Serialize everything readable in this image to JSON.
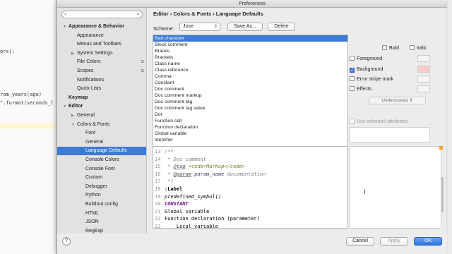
{
  "background_editor": {
    "lines": [
      "ors):",
      "rom_years(age)",
      "\".format(seconds_l"
    ]
  },
  "window": {
    "title": "Preferences"
  },
  "sidebar": {
    "search_placeholder": "",
    "items": [
      {
        "label": "Appearance & Behavior",
        "arrow": "▼",
        "bold": true
      },
      {
        "label": "Appearance"
      },
      {
        "label": "Menus and Toolbars"
      },
      {
        "label": "System Settings",
        "arrow": "▶"
      },
      {
        "label": "File Colors",
        "project_icon": "copy-icon"
      },
      {
        "label": "Scopes",
        "project_icon": "copy-icon"
      },
      {
        "label": "Notifications"
      },
      {
        "label": "Quick Lists"
      },
      {
        "label": "Keymap",
        "bold": true
      },
      {
        "label": "Editor",
        "arrow": "▼",
        "bold": true
      },
      {
        "label": "General",
        "arrow": "▶"
      },
      {
        "label": "Colors & Fonts",
        "arrow": "▼"
      },
      {
        "label": "Font"
      },
      {
        "label": "General"
      },
      {
        "label": "Language Defaults",
        "selected": true
      },
      {
        "label": "Console Colors"
      },
      {
        "label": "Console Font"
      },
      {
        "label": "Custom"
      },
      {
        "label": "Debugger"
      },
      {
        "label": "Python"
      },
      {
        "label": "Buildout config"
      },
      {
        "label": "HTML"
      },
      {
        "label": "JSON"
      },
      {
        "label": "RegExp"
      }
    ]
  },
  "main": {
    "breadcrumb": "Editor › Colors & Fonts › Language Defaults",
    "scheme_label": "Scheme:",
    "scheme_value": "Jose",
    "save_as_label": "Save As...",
    "delete_label": "Delete",
    "elements": [
      "Bad character",
      "Block comment",
      "Braces",
      "Brackets",
      "Class name",
      "Class reference",
      "Comma",
      "Constant",
      "Doc comment",
      "Doc comment markup",
      "Doc comment tag",
      "Doc comment tag value",
      "Dot",
      "Function call",
      "Function declaration",
      "Global variable",
      "Identifier"
    ],
    "selected_element": "Bad character",
    "attributes": {
      "bold": "Bold",
      "italic": "Italic",
      "foreground": "Foreground",
      "background": "Background",
      "error_stripe": "Error stripe mark",
      "effects": "Effects",
      "effect_type": "Underscored",
      "inherit": "Use inherited attributes"
    },
    "preview_lines": [
      {
        "n": "13",
        "parts": [
          {
            "t": "/**",
            "c": "c-doc"
          }
        ]
      },
      {
        "n": "14",
        "parts": [
          {
            "t": " * Doc comment",
            "c": "c-doc"
          }
        ]
      },
      {
        "n": "15",
        "parts": [
          {
            "t": " * ",
            "c": "c-doc"
          },
          {
            "t": "@tag",
            "c": "c-tag"
          },
          {
            "t": " ",
            "c": "c-doc"
          },
          {
            "t": "<code>Markup</code>",
            "c": "c-markup"
          }
        ]
      },
      {
        "n": "16",
        "parts": [
          {
            "t": " * ",
            "c": "c-doc"
          },
          {
            "t": "@param",
            "c": "c-tag"
          },
          {
            "t": " ",
            "c": "c-doc"
          },
          {
            "t": "param_name",
            "c": "c-param"
          },
          {
            "t": " documentation",
            "c": "c-doc"
          }
        ]
      },
      {
        "n": "17",
        "parts": [
          {
            "t": " */",
            "c": "c-doc"
          }
        ]
      },
      {
        "n": "18",
        "parts": [
          {
            "t": ":Label",
            "c": "c-label"
          }
        ]
      },
      {
        "n": "19",
        "parts": [
          {
            "t": "predefined_symbol()",
            "c": "c-predef"
          }
        ]
      },
      {
        "n": "20",
        "parts": [
          {
            "t": "CONSTANT",
            "c": "c-const"
          }
        ]
      },
      {
        "n": "21",
        "parts": [
          {
            "t": "Global variable",
            "c": "c-plain"
          }
        ]
      },
      {
        "n": "22",
        "parts": [
          {
            "t": "Function declaration (parameter)",
            "c": "c-plain"
          }
        ]
      },
      {
        "n": "23",
        "parts": [
          {
            "t": "    Local variable",
            "c": "c-plain"
          }
        ]
      }
    ]
  },
  "bottom": {
    "help_label": "?",
    "cancel_label": "Cancel",
    "apply_label": "Apply",
    "ok_label": "OK"
  },
  "colors": {
    "selection": "#3d7ad6",
    "background_swatch": "#f9cccc"
  }
}
